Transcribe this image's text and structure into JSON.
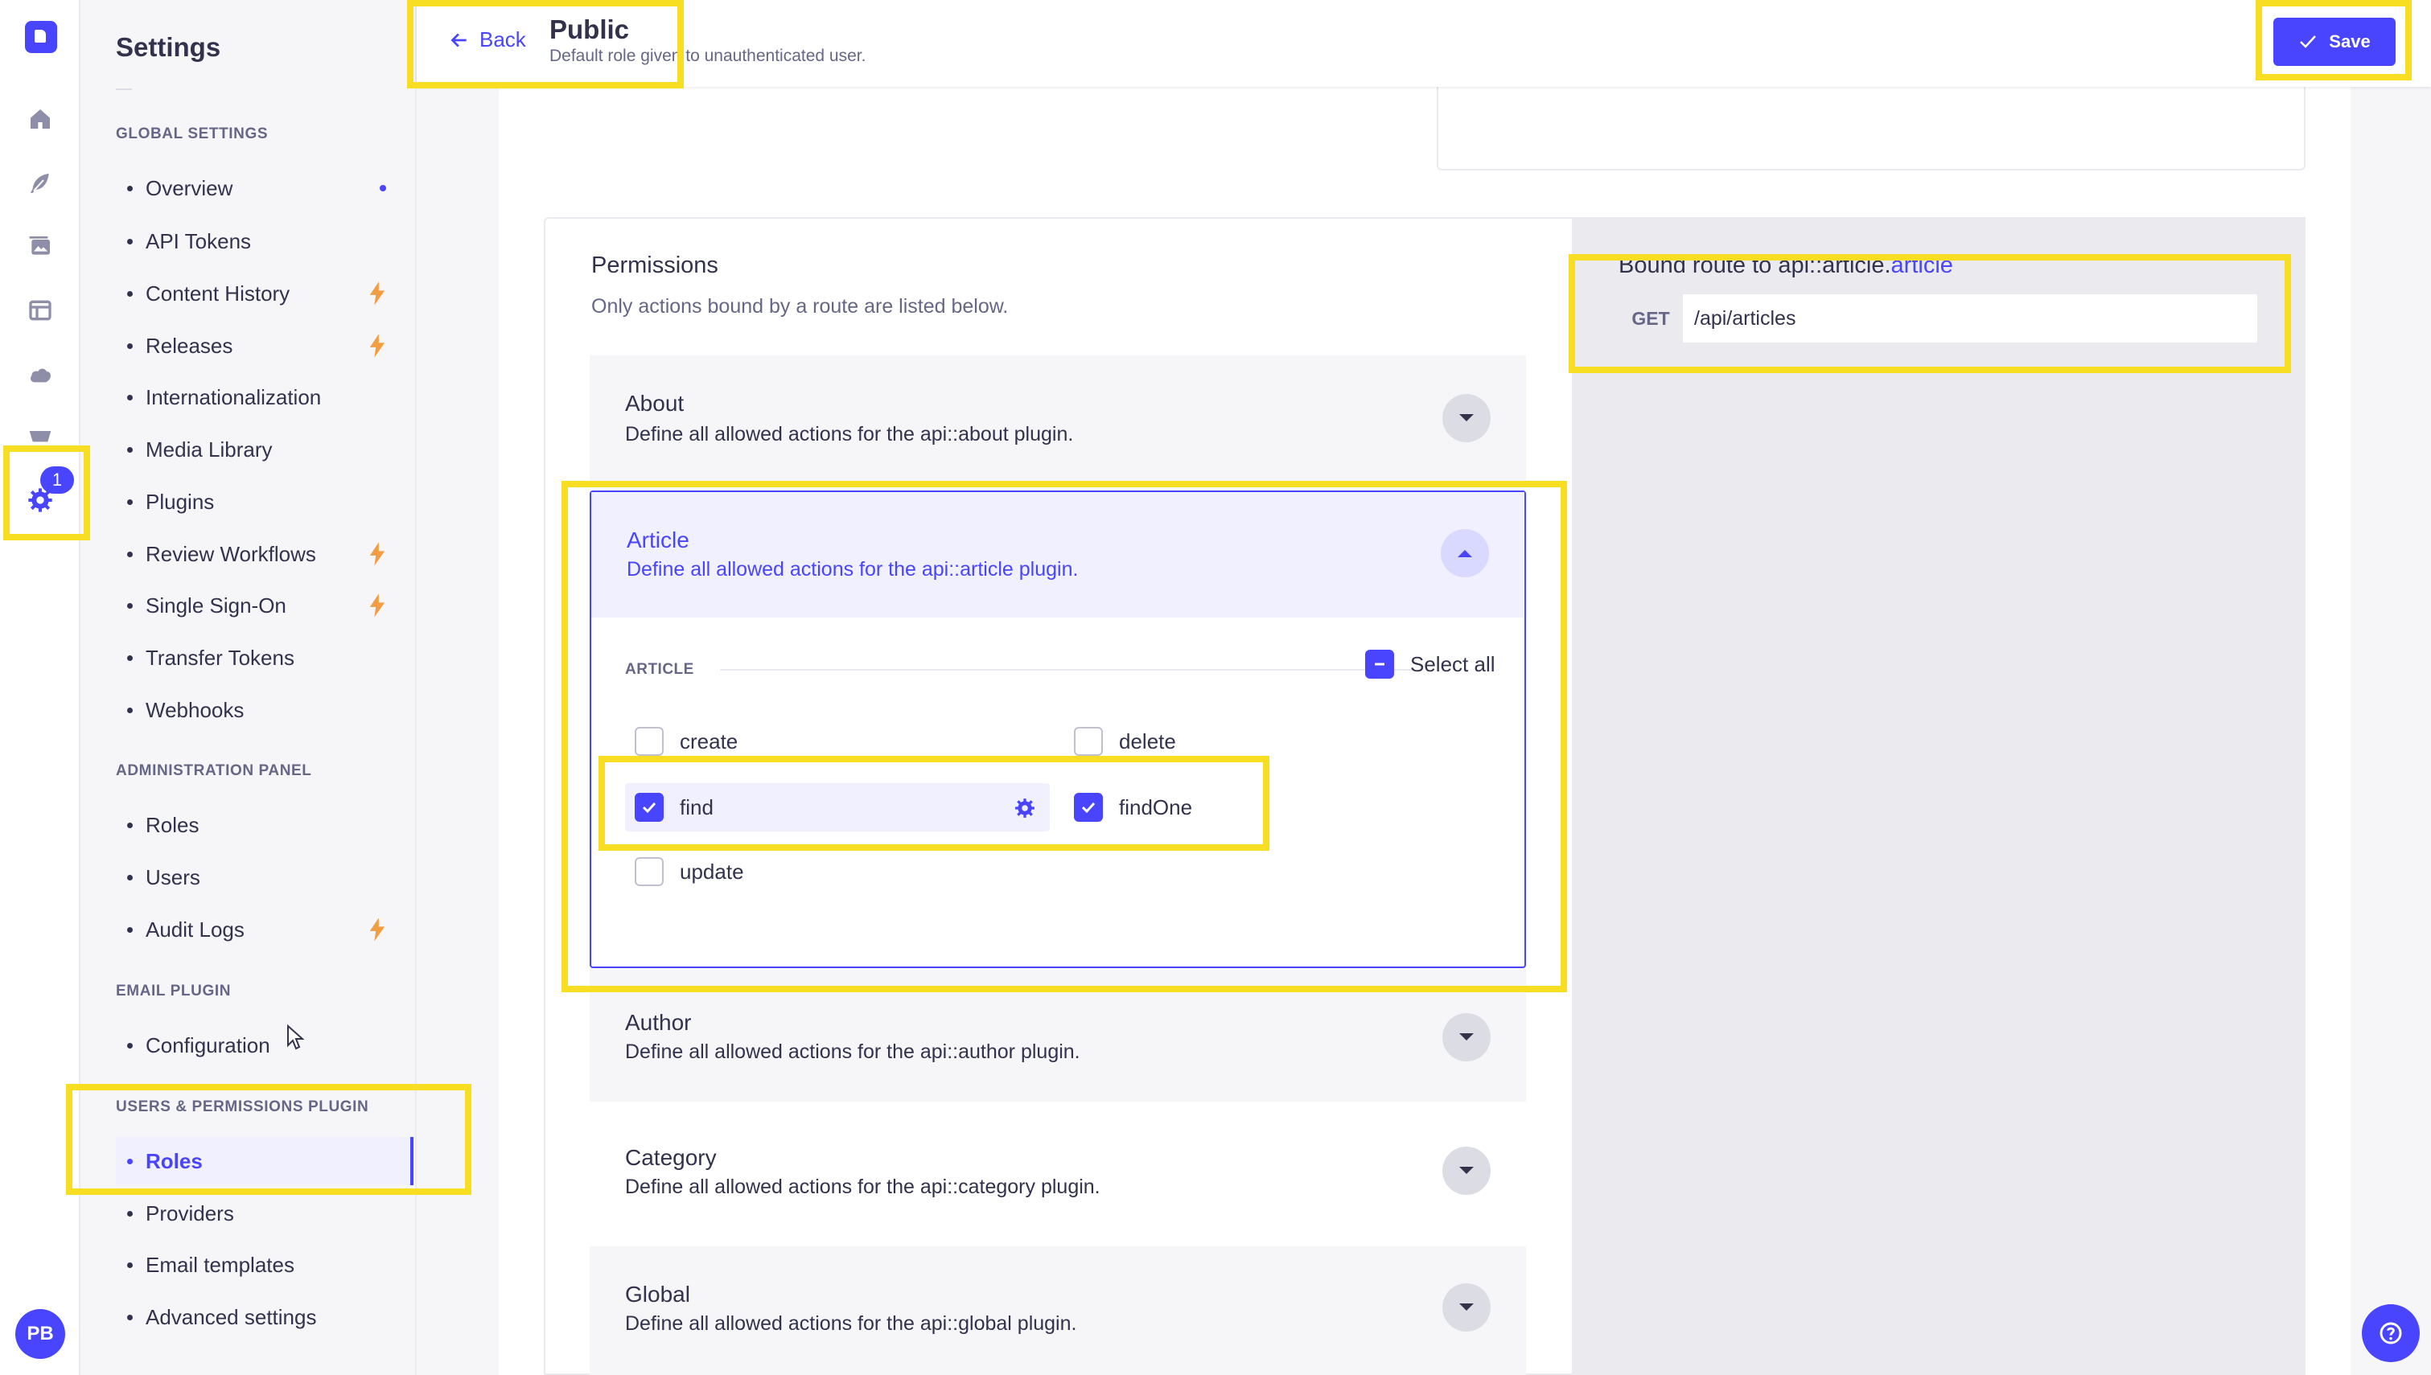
{
  "rail": {
    "badge_count": "1",
    "avatar_initials": "PB",
    "icons": [
      "strapi-logo-icon",
      "home-icon",
      "feather-icon",
      "media-icon",
      "layout-icon",
      "cloud-icon",
      "cart-icon",
      "settings-icon"
    ]
  },
  "subnav": {
    "title": "Settings",
    "sections": [
      {
        "title": "GLOBAL SETTINGS",
        "items": [
          {
            "label": "Overview",
            "trail": "dot"
          },
          {
            "label": "API Tokens",
            "trail": ""
          },
          {
            "label": "Content History",
            "trail": "bolt"
          },
          {
            "label": "Releases",
            "trail": "bolt"
          },
          {
            "label": "Internationalization",
            "trail": ""
          },
          {
            "label": "Media Library",
            "trail": ""
          },
          {
            "label": "Plugins",
            "trail": ""
          },
          {
            "label": "Review Workflows",
            "trail": "bolt"
          },
          {
            "label": "Single Sign-On",
            "trail": "bolt"
          },
          {
            "label": "Transfer Tokens",
            "trail": ""
          },
          {
            "label": "Webhooks",
            "trail": ""
          }
        ]
      },
      {
        "title": "ADMINISTRATION PANEL",
        "items": [
          {
            "label": "Roles",
            "trail": ""
          },
          {
            "label": "Users",
            "trail": ""
          },
          {
            "label": "Audit Logs",
            "trail": "bolt"
          }
        ]
      },
      {
        "title": "EMAIL PLUGIN",
        "items": [
          {
            "label": "Configuration",
            "trail": ""
          }
        ]
      },
      {
        "title": "USERS & PERMISSIONS PLUGIN",
        "items": [
          {
            "label": "Roles",
            "trail": "",
            "active": true
          },
          {
            "label": "Providers",
            "trail": ""
          },
          {
            "label": "Email templates",
            "trail": ""
          },
          {
            "label": "Advanced settings",
            "trail": ""
          }
        ]
      }
    ]
  },
  "header": {
    "back_label": "Back",
    "title": "Public",
    "subtitle": "Default role given to unauthenticated user.",
    "save_label": "Save"
  },
  "permissions": {
    "title": "Permissions",
    "subtitle": "Only actions bound by a route are listed below.",
    "accordions": [
      {
        "title": "About",
        "desc": "Define all allowed actions for the api::about plugin."
      },
      {
        "title": "Article",
        "desc": "Define all allowed actions for the api::article plugin.",
        "open": true
      },
      {
        "title": "Author",
        "desc": "Define all allowed actions for the api::author plugin."
      },
      {
        "title": "Category",
        "desc": "Define all allowed actions for the api::category plugin."
      },
      {
        "title": "Global",
        "desc": "Define all allowed actions for the api::global plugin."
      }
    ],
    "article": {
      "group_label": "ARTICLE",
      "select_all_label": "Select all",
      "actions": [
        {
          "label": "create",
          "checked": false
        },
        {
          "label": "delete",
          "checked": false
        },
        {
          "label": "find",
          "checked": true
        },
        {
          "label": "findOne",
          "checked": true
        },
        {
          "label": "update",
          "checked": false
        }
      ]
    }
  },
  "route": {
    "heading_prefix": "Bound route to api::article.",
    "heading_highlight": "article",
    "method": "GET",
    "path": "/api/articles"
  },
  "colors": {
    "primary": "#4945ff",
    "highlight_box": "#f8de22",
    "warning_bolt": "#f29d41"
  }
}
